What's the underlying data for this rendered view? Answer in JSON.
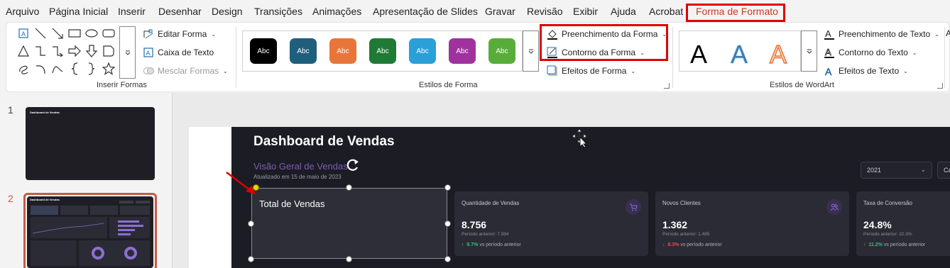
{
  "menu": {
    "items": [
      "Arquivo",
      "Página Inicial",
      "Inserir",
      "Desenhar",
      "Design",
      "Transições",
      "Animações",
      "Apresentação de Slides",
      "Gravar",
      "Revisão",
      "Exibir",
      "Ajuda",
      "Acrobat",
      "Forma de Formato"
    ],
    "active": "Forma de Formato"
  },
  "ribbon": {
    "insert_shapes": {
      "label": "Inserir Formas",
      "edit_shape": "Editar Forma",
      "text_box": "Caixa de Texto",
      "merge_shapes": "Mesclar Formas"
    },
    "shape_styles": {
      "label": "Estilos de Forma",
      "swatches": [
        {
          "text": "Abc",
          "color": "#000000"
        },
        {
          "text": "Abc",
          "color": "#1f5f7e"
        },
        {
          "text": "Abc",
          "color": "#e8763a"
        },
        {
          "text": "Abc",
          "color": "#1f7a35"
        },
        {
          "text": "Abc",
          "color": "#2a9fd8"
        },
        {
          "text": "Abc",
          "color": "#a0329e"
        },
        {
          "text": "Abc",
          "color": "#58ad3a"
        }
      ],
      "shape_fill": "Preenchimento da Forma",
      "shape_outline": "Contorno da Forma",
      "shape_effects": "Efeitos de Forma"
    },
    "wordart_styles": {
      "label": "Estilos de WordArt",
      "letters": [
        "A",
        "A",
        "A"
      ],
      "text_fill": "Preenchimento de Texto",
      "text_outline": "Contorno do Texto",
      "text_effects": "Efeitos de Texto",
      "cut_off": "A"
    }
  },
  "thumbnails": [
    {
      "number": "1",
      "title": "Dashboard de Vendas"
    },
    {
      "number": "2",
      "title": "Dashboard de Vendas"
    }
  ],
  "slide": {
    "title": "Dashboard de Vendas",
    "subtitle": "Visão Geral de Vendas",
    "updated": "Atualizado em 15 de maio de 2023",
    "year_select": "2021",
    "second_select": "Ca",
    "selected_box_text": "Total de Vendas",
    "cards": [
      {
        "label": "Quantidade de Vendas",
        "value": "8.756",
        "previous": "Período anterior: 7.984",
        "arrow": "↑",
        "change": "9.7%",
        "change_suffix": "vs período anterior",
        "icon": "cart-icon"
      },
      {
        "label": "Novos Clientes",
        "value": "1.362",
        "previous": "Período anterior: 1.485",
        "arrow": "↓",
        "change": "8.3%",
        "change_suffix": "vs período anterior",
        "icon": "users-icon"
      },
      {
        "label": "Taxa de Conversão",
        "value": "24.8%",
        "previous": "Período anterior: 22.3%",
        "arrow": "↑",
        "change": "11.2%",
        "change_suffix": "vs período anterior",
        "icon": "none"
      }
    ]
  },
  "colors": {
    "highlight_red": "#e00000",
    "accent_tab": "#c43e1c",
    "slide_dark": "#1b1c24",
    "card": "#2a2b35",
    "subtitle_purple": "#7b5fae",
    "up_green": "#35c07a",
    "down_red": "#ef4b4b"
  }
}
